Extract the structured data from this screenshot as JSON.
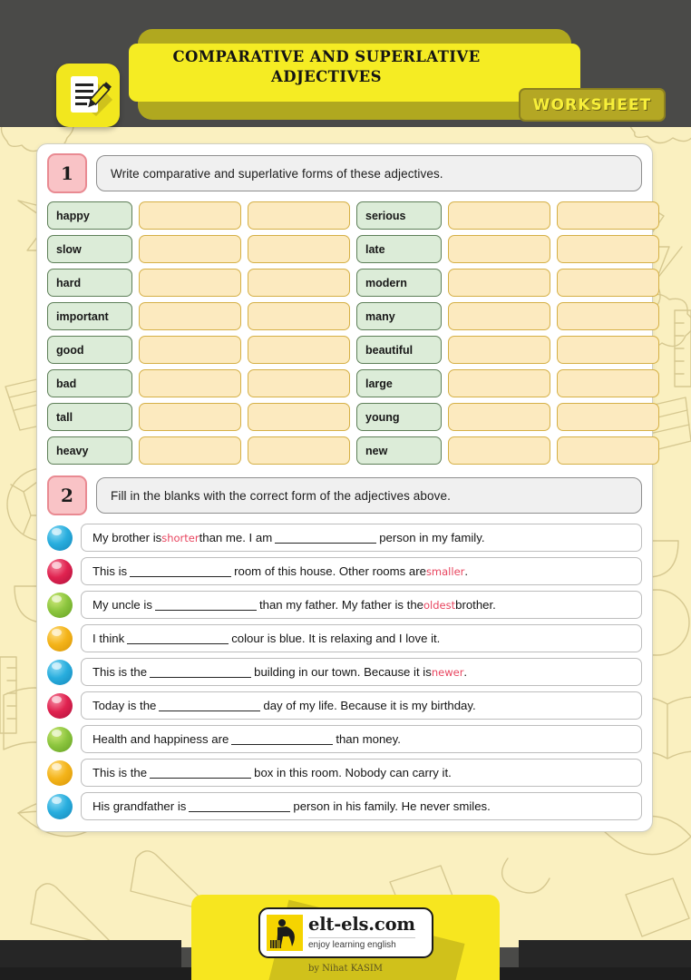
{
  "header": {
    "title": "COMPARATIVE AND SUPERLATIVE ADJECTIVES",
    "badge_label": "WORKSHEET",
    "icon": "document-pencil-icon",
    "band_color": "#f5ec23",
    "badge_bg": "#b4a724",
    "badge_text_color": "#f7ef3a"
  },
  "exercise1": {
    "number": "1",
    "prompt": "Write comparative and superlative forms of these adjectives.",
    "word_cell_color": "#dcecd8",
    "blank_cell_color": "#fceabf",
    "rows": [
      {
        "left": "happy",
        "right": "serious"
      },
      {
        "left": "slow",
        "right": "late"
      },
      {
        "left": "hard",
        "right": "modern"
      },
      {
        "left": "important",
        "right": "many"
      },
      {
        "left": "good",
        "right": "beautiful"
      },
      {
        "left": "bad",
        "right": "large"
      },
      {
        "left": "tall",
        "right": "young"
      },
      {
        "left": "heavy",
        "right": "new"
      }
    ]
  },
  "exercise2": {
    "number": "2",
    "prompt": "Fill in the blanks with the correct form of the adjectives above.",
    "highlight_color": "#e8455f",
    "items": [
      {
        "ball": "blue",
        "parts": [
          {
            "t": "text",
            "v": "My brother is "
          },
          {
            "t": "highlight",
            "v": "shorter"
          },
          {
            "t": "text",
            "v": " than me. I am "
          },
          {
            "t": "blank",
            "v": ""
          },
          {
            "t": "text",
            "v": " person in my family."
          }
        ]
      },
      {
        "ball": "red",
        "parts": [
          {
            "t": "text",
            "v": "This is "
          },
          {
            "t": "blank",
            "v": ""
          },
          {
            "t": "text",
            "v": " room of this house. Other rooms are "
          },
          {
            "t": "highlight",
            "v": "smaller"
          },
          {
            "t": "text",
            "v": "."
          }
        ]
      },
      {
        "ball": "green",
        "parts": [
          {
            "t": "text",
            "v": "My uncle is "
          },
          {
            "t": "blank",
            "v": ""
          },
          {
            "t": "text",
            "v": " than my father. My father is the "
          },
          {
            "t": "highlight",
            "v": "oldest"
          },
          {
            "t": "text",
            "v": " brother."
          }
        ]
      },
      {
        "ball": "yellow",
        "parts": [
          {
            "t": "text",
            "v": "I think "
          },
          {
            "t": "blank",
            "v": ""
          },
          {
            "t": "text",
            "v": " colour is blue. It is relaxing and I love it."
          }
        ]
      },
      {
        "ball": "blue",
        "parts": [
          {
            "t": "text",
            "v": "This is the "
          },
          {
            "t": "blank",
            "v": ""
          },
          {
            "t": "text",
            "v": " building in our town. Because it is "
          },
          {
            "t": "highlight",
            "v": "newer"
          },
          {
            "t": "text",
            "v": "."
          }
        ]
      },
      {
        "ball": "red",
        "parts": [
          {
            "t": "text",
            "v": "Today is the "
          },
          {
            "t": "blank",
            "v": ""
          },
          {
            "t": "text",
            "v": " day of my life. Because it is my birthday."
          }
        ]
      },
      {
        "ball": "green",
        "parts": [
          {
            "t": "text",
            "v": "Health and happiness are "
          },
          {
            "t": "blank",
            "v": ""
          },
          {
            "t": "text",
            "v": " than money."
          }
        ]
      },
      {
        "ball": "yellow",
        "parts": [
          {
            "t": "text",
            "v": "This is the "
          },
          {
            "t": "blank",
            "v": ""
          },
          {
            "t": "text",
            "v": " box in this room. Nobody can carry it."
          }
        ]
      },
      {
        "ball": "blue",
        "parts": [
          {
            "t": "text",
            "v": "His grandfather is "
          },
          {
            "t": "blank",
            "v": ""
          },
          {
            "t": "text",
            "v": " person in his family. He never smiles."
          }
        ]
      }
    ]
  },
  "footer": {
    "logo_name": "elt-els.com",
    "logo_tagline": "enjoy learning english",
    "byline": "by Nihat KASIM",
    "bg_color": "#f7e61f"
  }
}
